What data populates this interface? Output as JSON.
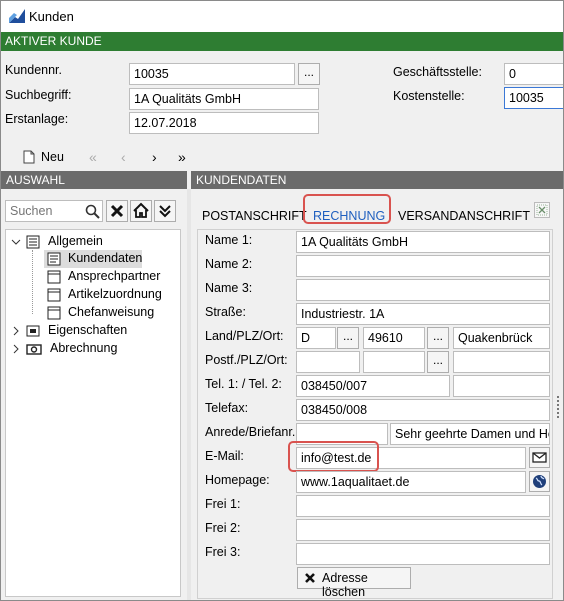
{
  "window": {
    "title": "Kunden"
  },
  "banner": "AKTIVER KUNDE",
  "header": {
    "kundennr_label": "Kundennr.",
    "kundennr_value": "10035",
    "suchbegriff_label": "Suchbegriff:",
    "suchbegriff_value": "1A Qualitäts GmbH",
    "erstanlage_label": "Erstanlage:",
    "erstanlage_value": "12.07.2018",
    "geschaeftsstelle_label": "Geschäftsstelle:",
    "geschaeftsstelle_value": "0",
    "kostenstelle_label": "Kostenstelle:",
    "kostenstelle_value": "10035",
    "lookup_button": "..."
  },
  "toolbar": {
    "new_label": "Neu",
    "first": "«",
    "prev": "‹",
    "next": "›",
    "last": "»"
  },
  "left": {
    "section_title": "AUSWAHL",
    "search_placeholder": "Suchen",
    "tree": [
      {
        "label": "Allgemein"
      },
      {
        "label": "Kundendaten"
      },
      {
        "label": "Ansprechpartner"
      },
      {
        "label": "Artikelzuordnung"
      },
      {
        "label": "Chefanweisung"
      },
      {
        "label": "Eigenschaften"
      },
      {
        "label": "Abrechnung"
      }
    ]
  },
  "right": {
    "section_title": "KUNDENDATEN",
    "tabs": [
      {
        "label": "POSTANSCHRIFT"
      },
      {
        "label": "RECHNUNG"
      },
      {
        "label": "VERSANDANSCHRIFT"
      }
    ],
    "fields": {
      "name1_label": "Name 1:",
      "name1_value": "1A Qualitäts GmbH",
      "name2_label": "Name 2:",
      "name2_value": "",
      "name3_label": "Name 3:",
      "name3_value": "",
      "strasse_label": "Straße:",
      "strasse_value": "Industriestr. 1A",
      "landplzort_label": "Land/PLZ/Ort:",
      "land_value": "D",
      "plz_value": "49610",
      "ort_value": "Quakenbrück",
      "postfach_label": "Postf./PLZ/Ort:",
      "tel_label": "Tel. 1: / Tel. 2:",
      "tel1_value": "038450/007",
      "tel2_value": "",
      "telefax_label": "Telefax:",
      "telefax_value": "038450/008",
      "anrede_label": "Anrede/Briefanr.:",
      "anrede_value": "",
      "briefanrede_value": "Sehr geehrte Damen und Herr",
      "email_label": "E-Mail:",
      "email_value": "info@test.de",
      "homepage_label": "Homepage:",
      "homepage_value": "www.1aqualitaet.de",
      "frei1_label": "Frei 1:",
      "frei2_label": "Frei 2:",
      "frei3_label": "Frei 3:"
    },
    "delete_button": "Adresse löschen"
  },
  "colors": {
    "accent_green": "#2e7d32",
    "section_gray": "#6b6b6b",
    "highlight_red": "#d9534f",
    "tab_active": "#1f5fbf"
  }
}
